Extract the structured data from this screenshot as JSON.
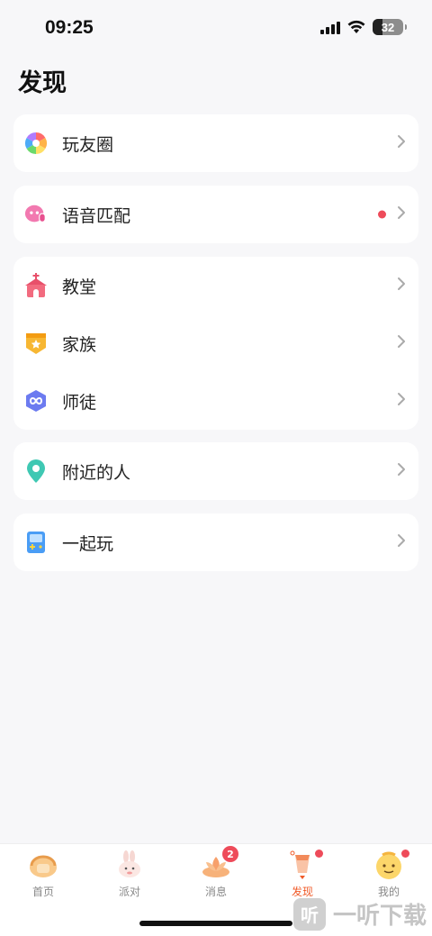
{
  "status_bar": {
    "time": "09:25",
    "battery_level": "32",
    "battery_percent": 32,
    "icons": [
      "signal-icon",
      "wifi-icon",
      "battery-icon"
    ]
  },
  "page": {
    "title": "发现"
  },
  "sections": [
    {
      "items": [
        {
          "label": "玩友圈",
          "icon": "pinwheel-icon"
        }
      ]
    },
    {
      "items": [
        {
          "label": "语音匹配",
          "icon": "voice-match-icon",
          "has_dot": true
        }
      ]
    },
    {
      "items": [
        {
          "label": "教堂",
          "icon": "church-icon"
        },
        {
          "label": "家族",
          "icon": "family-icon"
        },
        {
          "label": "师徒",
          "icon": "mentor-icon"
        }
      ]
    },
    {
      "items": [
        {
          "label": "附近的人",
          "icon": "location-pin-icon"
        }
      ]
    },
    {
      "items": [
        {
          "label": "一起玩",
          "icon": "game-console-icon"
        }
      ]
    }
  ],
  "tab_bar": {
    "tabs": [
      {
        "label": "首页",
        "icon": "home-icon",
        "active": false
      },
      {
        "label": "派对",
        "icon": "party-rabbit-icon",
        "active": false
      },
      {
        "label": "消息",
        "icon": "message-lotus-icon",
        "active": false,
        "badge": "2"
      },
      {
        "label": "发现",
        "icon": "discover-lantern-icon",
        "active": true,
        "has_dot": true
      },
      {
        "label": "我的",
        "icon": "profile-avatar-icon",
        "active": false,
        "has_dot": true
      }
    ]
  },
  "watermark": {
    "text": "一听下载",
    "logo": "听"
  },
  "colors": {
    "accent": "#f05a28",
    "badge_red": "#ee4b5a",
    "background": "#f7f7f9"
  }
}
